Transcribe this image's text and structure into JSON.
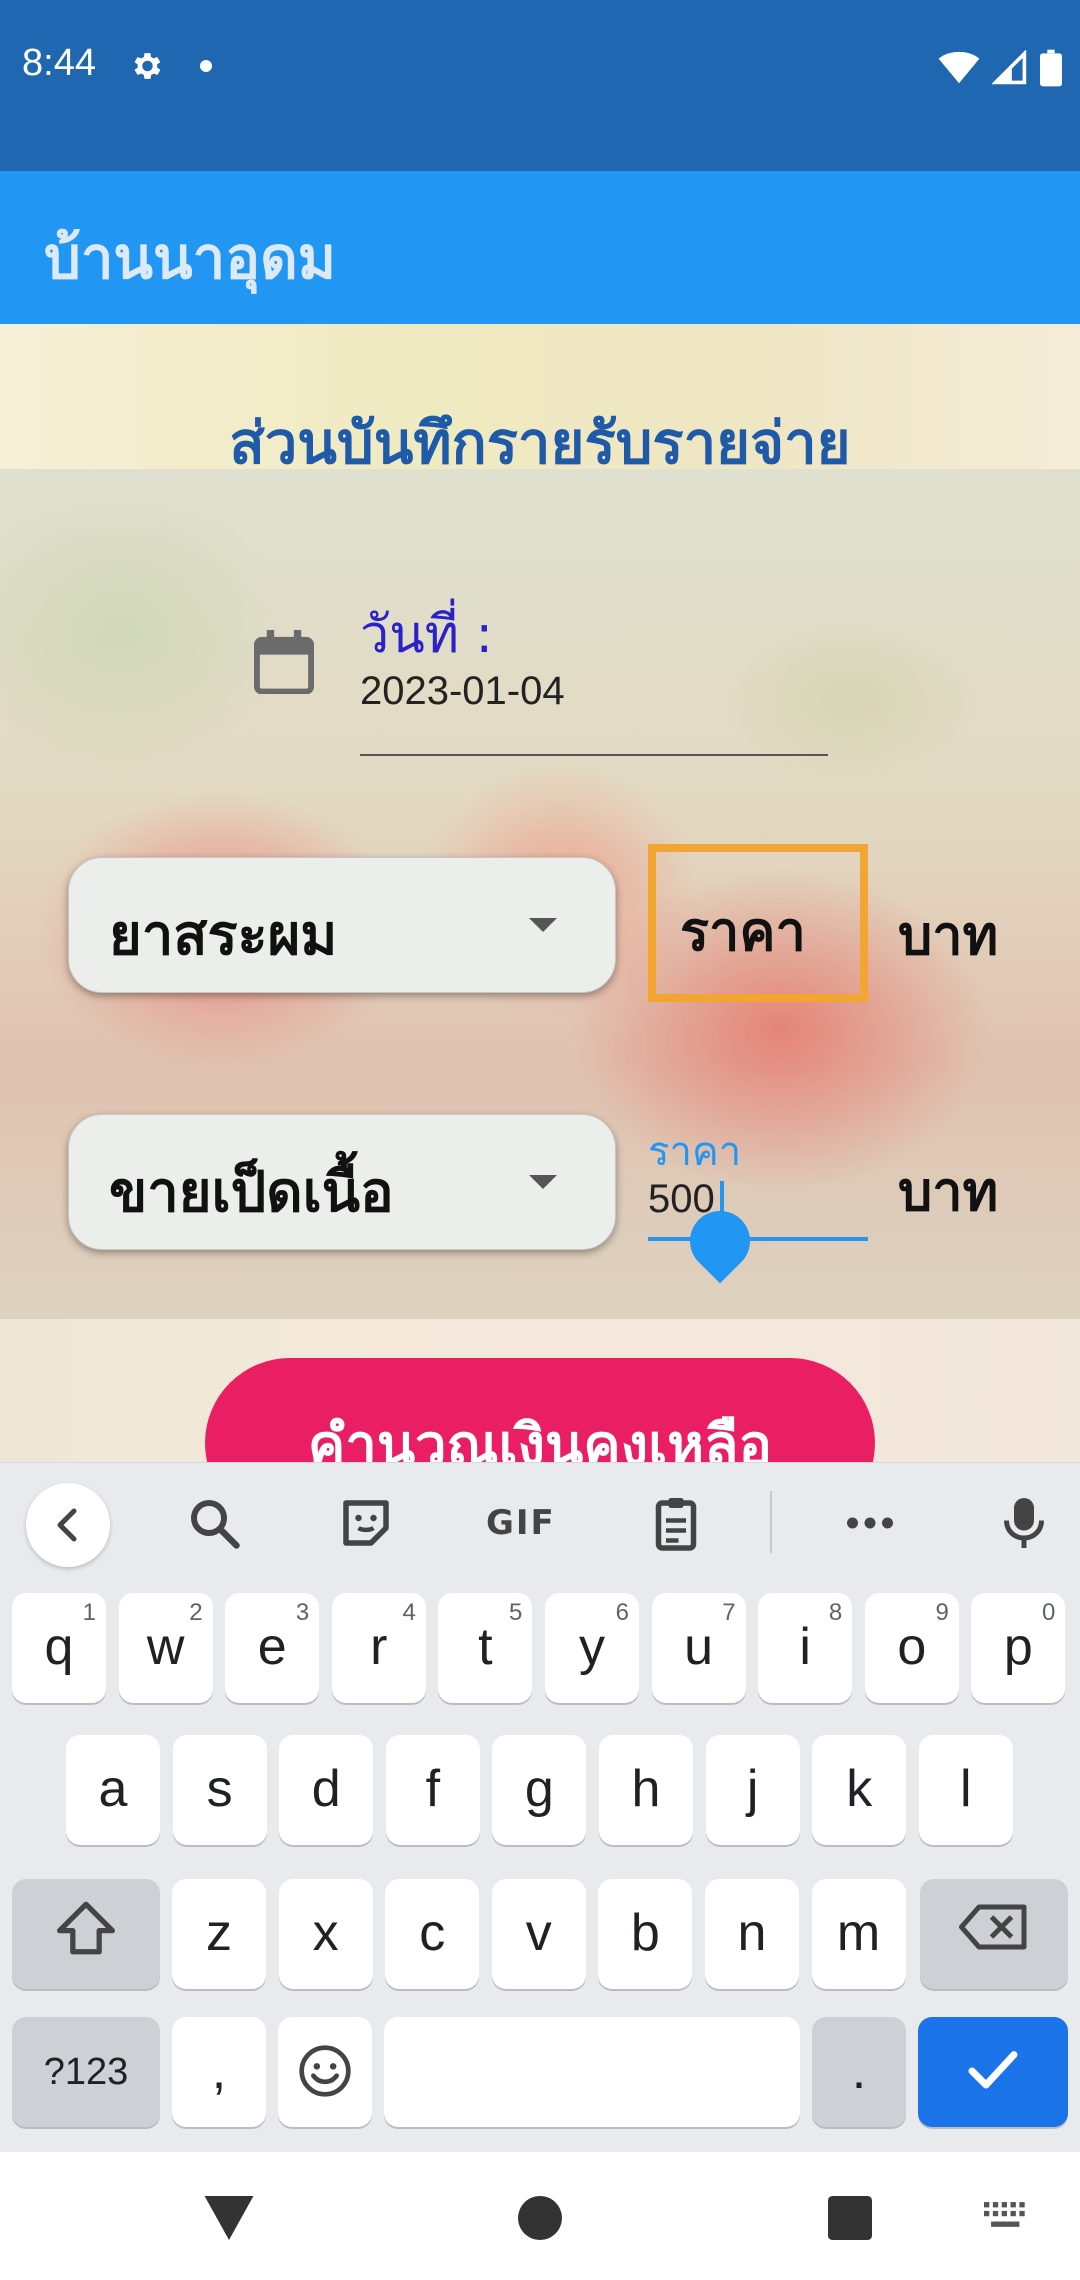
{
  "status_bar": {
    "time": "8:44",
    "icons": [
      "gear-icon",
      "notification-dot-icon",
      "wifi-icon",
      "cell-signal-icon",
      "battery-icon"
    ]
  },
  "app_bar": {
    "title": "บ้านนาอุดม"
  },
  "main": {
    "heading": "ส่วนบันทึกรายรับรายจ่าย",
    "date": {
      "label": "วันที่ :",
      "value": "2023-01-04"
    },
    "expense_row": {
      "category": "ยาสระผม",
      "price_placeholder": "ราคา",
      "unit": "บาท"
    },
    "income_row": {
      "category": "ขายเป็ดเนื้อ",
      "price_label": "ราคา",
      "price_value": "500",
      "unit": "บาท"
    },
    "calculate_button": "คำนวณเงินคงเหลือ"
  },
  "keyboard": {
    "toolbar": {
      "gif_label": "GIF",
      "icons": [
        "back-icon",
        "search-icon",
        "sticker-icon",
        "clipboard-icon",
        "more-icon",
        "mic-icon"
      ]
    },
    "row1": [
      {
        "key": "q",
        "hint": "1"
      },
      {
        "key": "w",
        "hint": "2"
      },
      {
        "key": "e",
        "hint": "3"
      },
      {
        "key": "r",
        "hint": "4"
      },
      {
        "key": "t",
        "hint": "5"
      },
      {
        "key": "y",
        "hint": "6"
      },
      {
        "key": "u",
        "hint": "7"
      },
      {
        "key": "i",
        "hint": "8"
      },
      {
        "key": "o",
        "hint": "9"
      },
      {
        "key": "p",
        "hint": "0"
      }
    ],
    "row2": [
      "a",
      "s",
      "d",
      "f",
      "g",
      "h",
      "j",
      "k",
      "l"
    ],
    "row3": [
      "z",
      "x",
      "c",
      "v",
      "b",
      "n",
      "m"
    ],
    "symbols_key": "?123",
    "comma_key": ",",
    "period_key": ".",
    "accent_color": "#1a73e8"
  },
  "colors": {
    "status_bar": "#1f67b0",
    "app_bar": "#2196f3",
    "heading": "#1f5aa8",
    "date_label": "#2a21c9",
    "price_focus_border": "#f2a532",
    "calculate_button": "#e91e63"
  }
}
